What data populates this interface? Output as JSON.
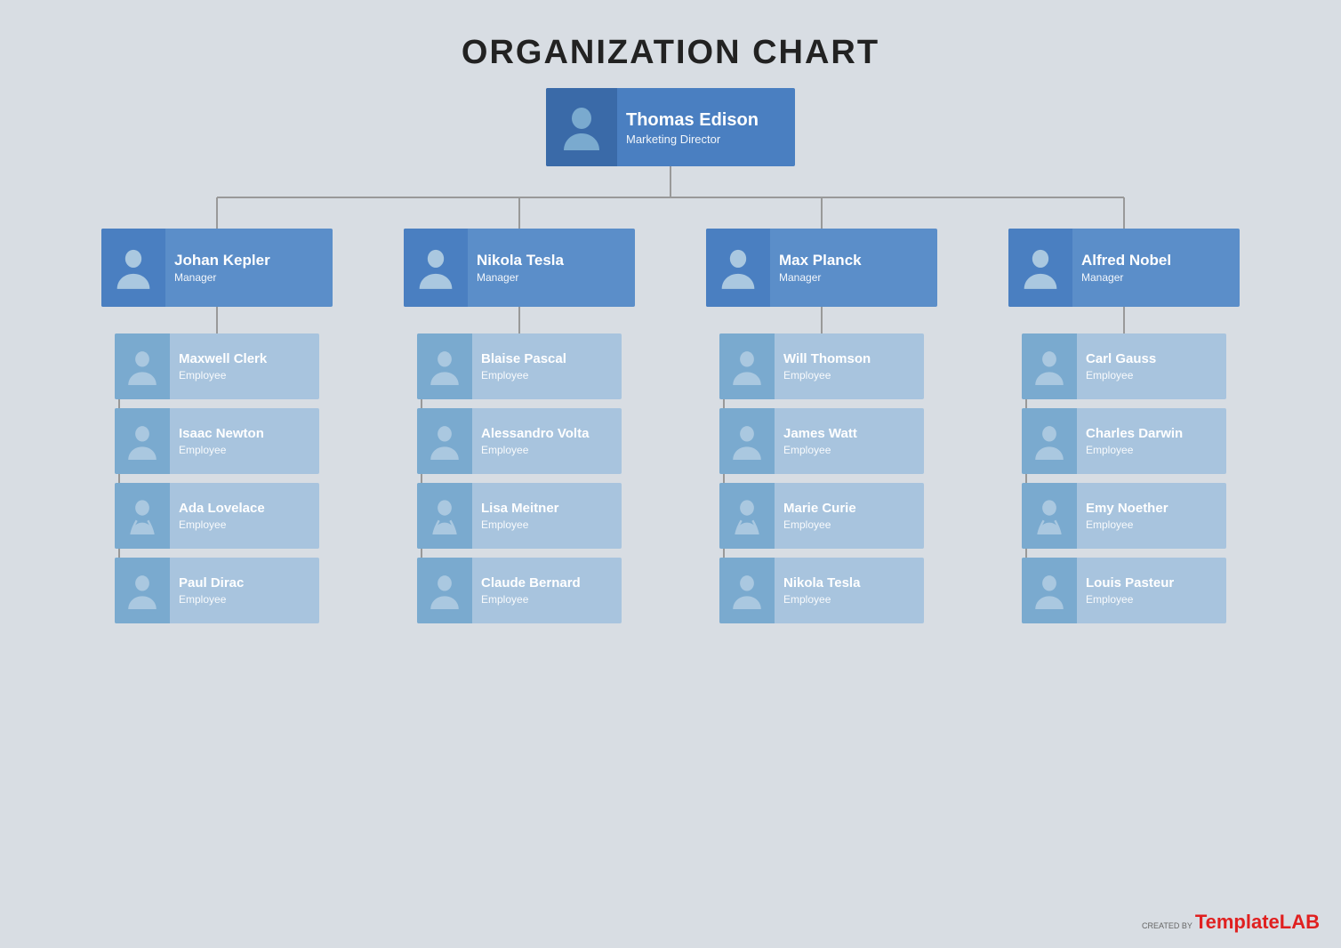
{
  "title": "ORGANIZATION CHART",
  "top": {
    "name": "Thomas Edison",
    "role": "Marketing Director"
  },
  "managers": [
    {
      "name": "Johan Kepler",
      "role": "Manager"
    },
    {
      "name": "Nikola Tesla",
      "role": "Manager"
    },
    {
      "name": "Max Planck",
      "role": "Manager"
    },
    {
      "name": "Alfred Nobel",
      "role": "Manager"
    }
  ],
  "employees": [
    [
      {
        "name": "Maxwell Clerk",
        "role": "Employee"
      },
      {
        "name": "Isaac Newton",
        "role": "Employee"
      },
      {
        "name": "Ada Lovelace",
        "role": "Employee"
      },
      {
        "name": "Paul Dirac",
        "role": "Employee"
      }
    ],
    [
      {
        "name": "Blaise Pascal",
        "role": "Employee"
      },
      {
        "name": "Alessandro Volta",
        "role": "Employee"
      },
      {
        "name": "Lisa Meitner",
        "role": "Employee"
      },
      {
        "name": "Claude Bernard",
        "role": "Employee"
      }
    ],
    [
      {
        "name": "Will Thomson",
        "role": "Employee"
      },
      {
        "name": "James Watt",
        "role": "Employee"
      },
      {
        "name": "Marie Curie",
        "role": "Employee"
      },
      {
        "name": "Nikola Tesla",
        "role": "Employee"
      }
    ],
    [
      {
        "name": "Carl Gauss",
        "role": "Employee"
      },
      {
        "name": "Charles Darwin",
        "role": "Employee"
      },
      {
        "name": "Emy Noether",
        "role": "Employee"
      },
      {
        "name": "Louis Pasteur",
        "role": "Employee"
      }
    ]
  ],
  "watermark": {
    "created_by": "CREATED BY",
    "brand_plain": "Template",
    "brand_colored": "LAB"
  }
}
